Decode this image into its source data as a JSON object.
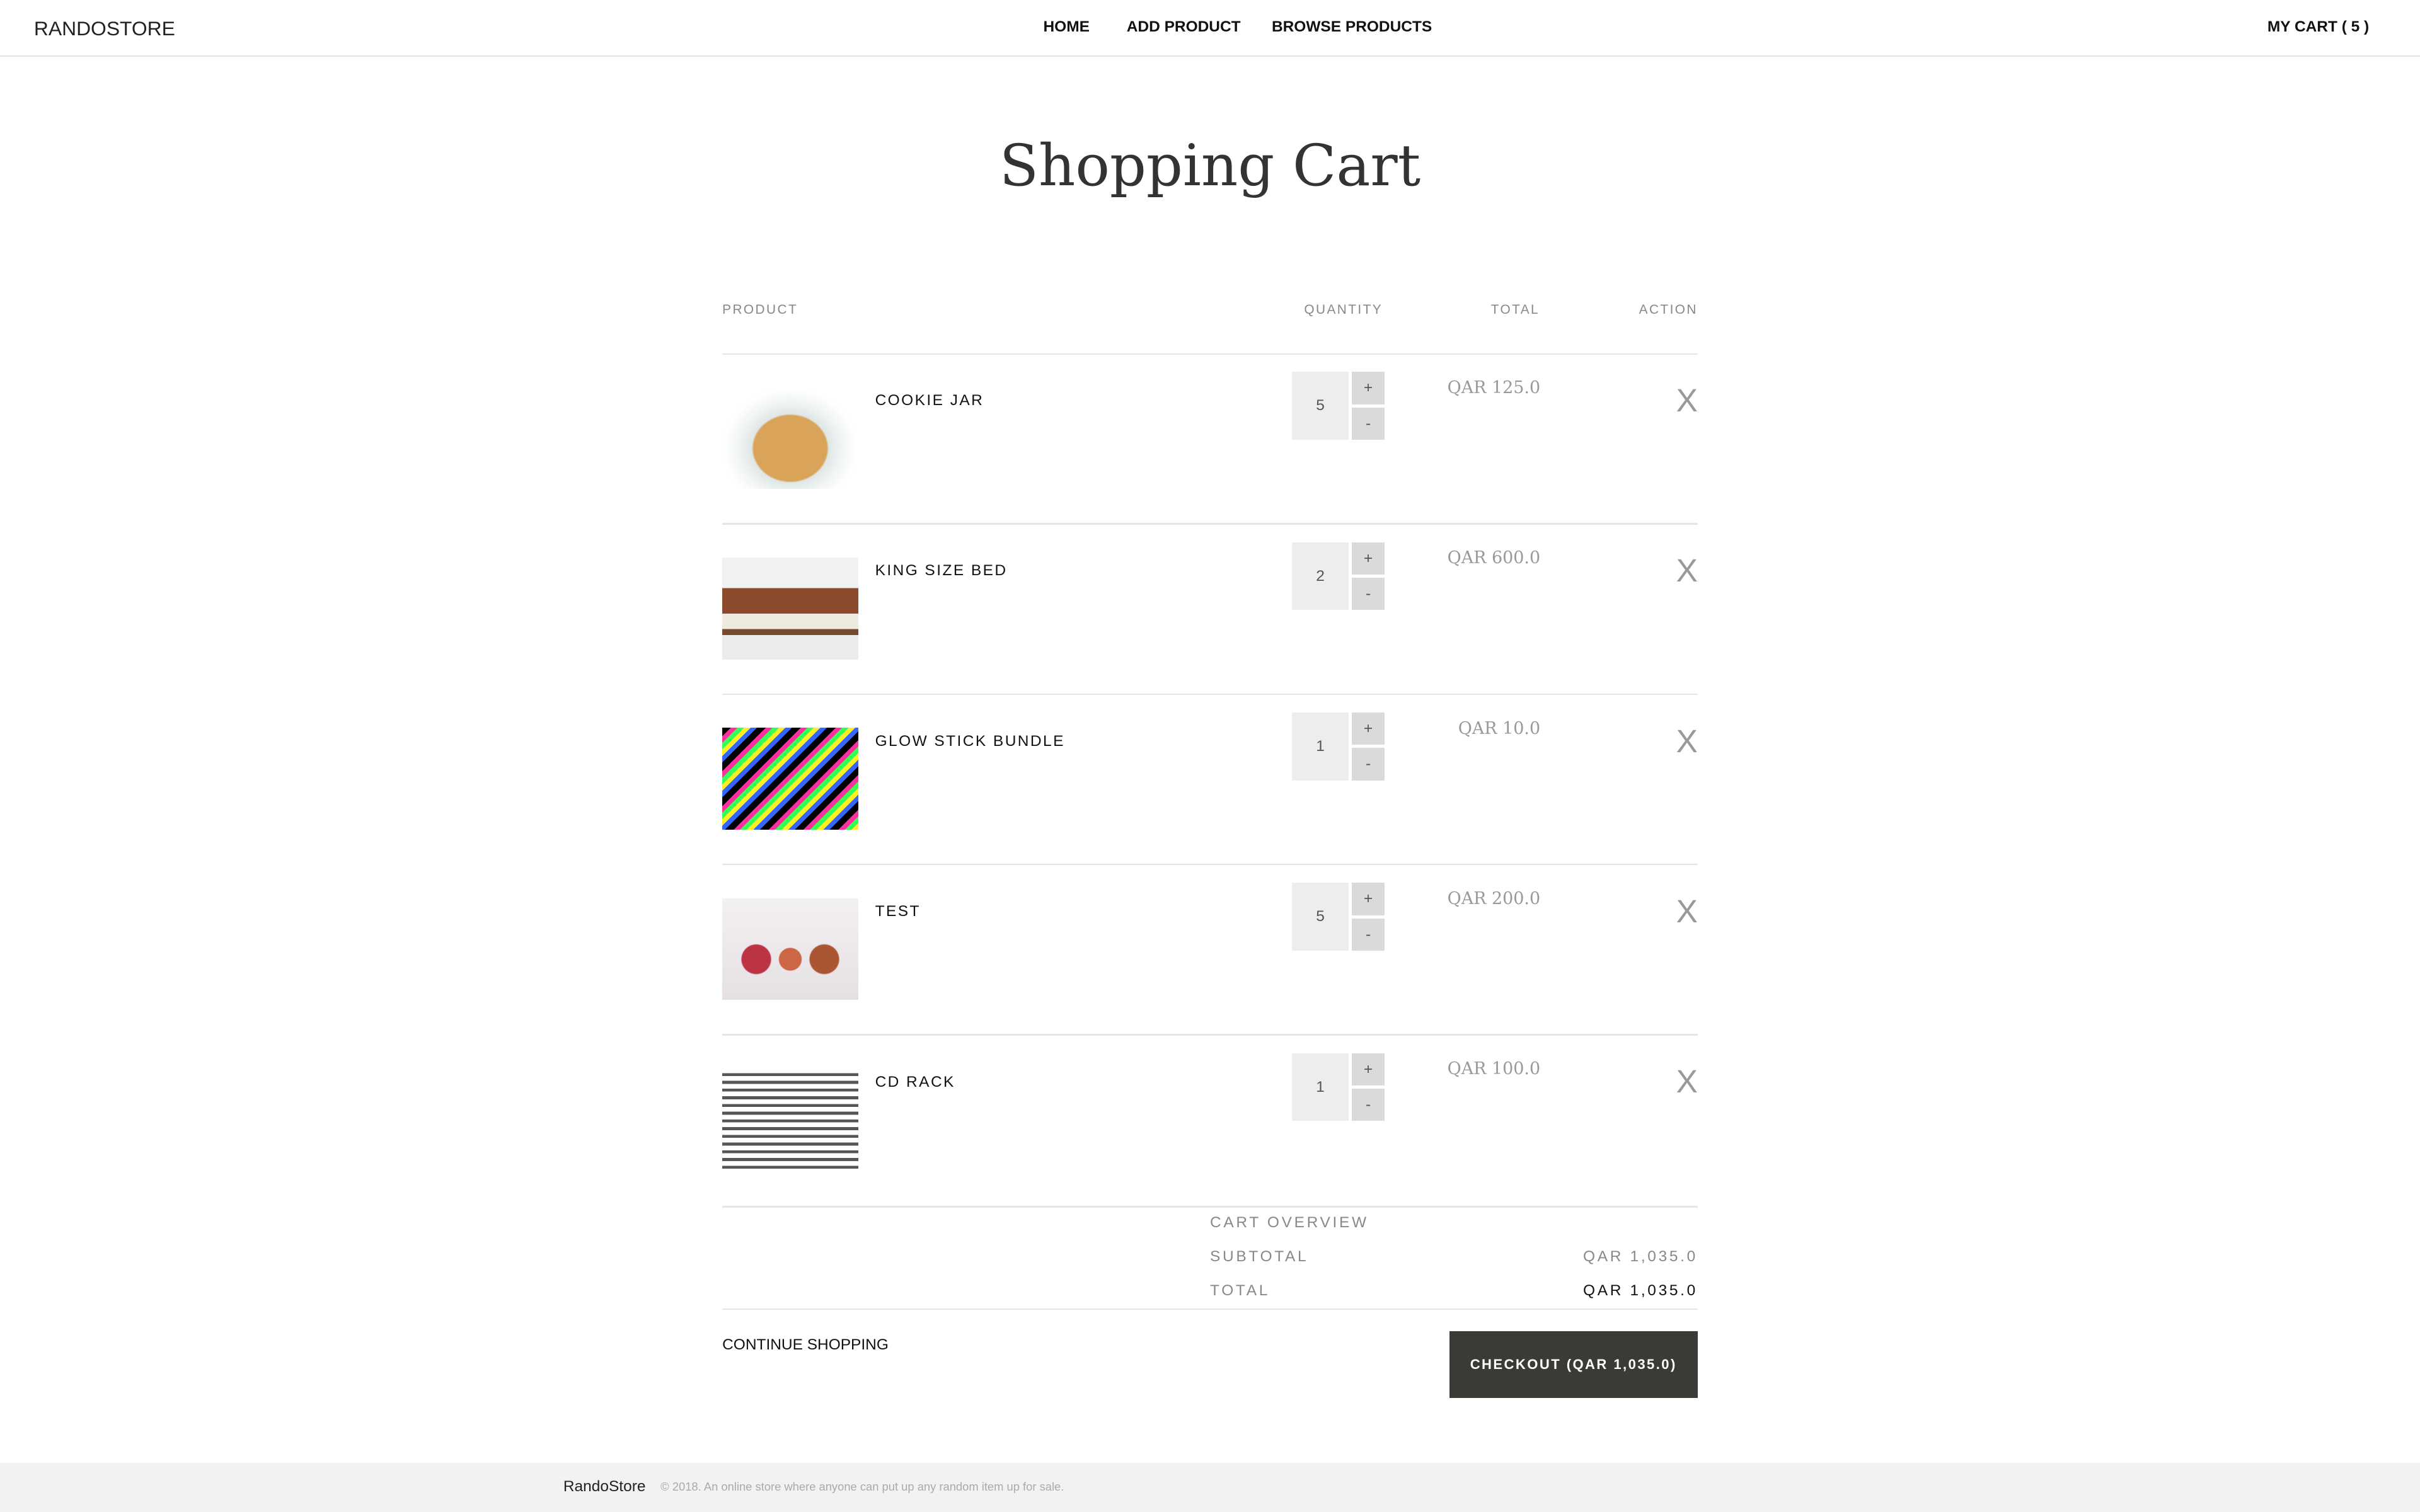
{
  "nav": {
    "brand": "RANDOSTORE",
    "home": "HOME",
    "add_product": "ADD PRODUCT",
    "browse_products": "BROWSE PRODUCTS",
    "cart": "MY CART ( 5 )"
  },
  "page_title": "Shopping Cart",
  "table_headers": {
    "product": "PRODUCT",
    "quantity": "QUANTITY",
    "total": "TOTAL",
    "action": "ACTION"
  },
  "items": [
    {
      "name": "COOKIE JAR",
      "quantity": "5",
      "total": "QAR 125.0",
      "remove": "X",
      "plus": "+",
      "minus": "-"
    },
    {
      "name": "KING SIZE BED",
      "quantity": "2",
      "total": "QAR 600.0",
      "remove": "X",
      "plus": "+",
      "minus": "-"
    },
    {
      "name": "GLOW STICK BUNDLE",
      "quantity": "1",
      "total": "QAR 10.0",
      "remove": "X",
      "plus": "+",
      "minus": "-"
    },
    {
      "name": "TEST",
      "quantity": "5",
      "total": "QAR 200.0",
      "remove": "X",
      "plus": "+",
      "minus": "-"
    },
    {
      "name": "CD RACK",
      "quantity": "1",
      "total": "QAR 100.0",
      "remove": "X",
      "plus": "+",
      "minus": "-"
    }
  ],
  "overview": {
    "heading": "CART OVERVIEW",
    "subtotal_label": "SUBTOTAL",
    "subtotal": "QAR 1,035.0",
    "total_label": "TOTAL",
    "total": "QAR 1,035.0"
  },
  "actions": {
    "continue": "CONTINUE SHOPPING",
    "checkout": "CHECKOUT (QAR 1,035.0)"
  },
  "footer": {
    "brand": "RandoStore",
    "text": "© 2018. An online store where anyone can put up any random item up for sale."
  }
}
